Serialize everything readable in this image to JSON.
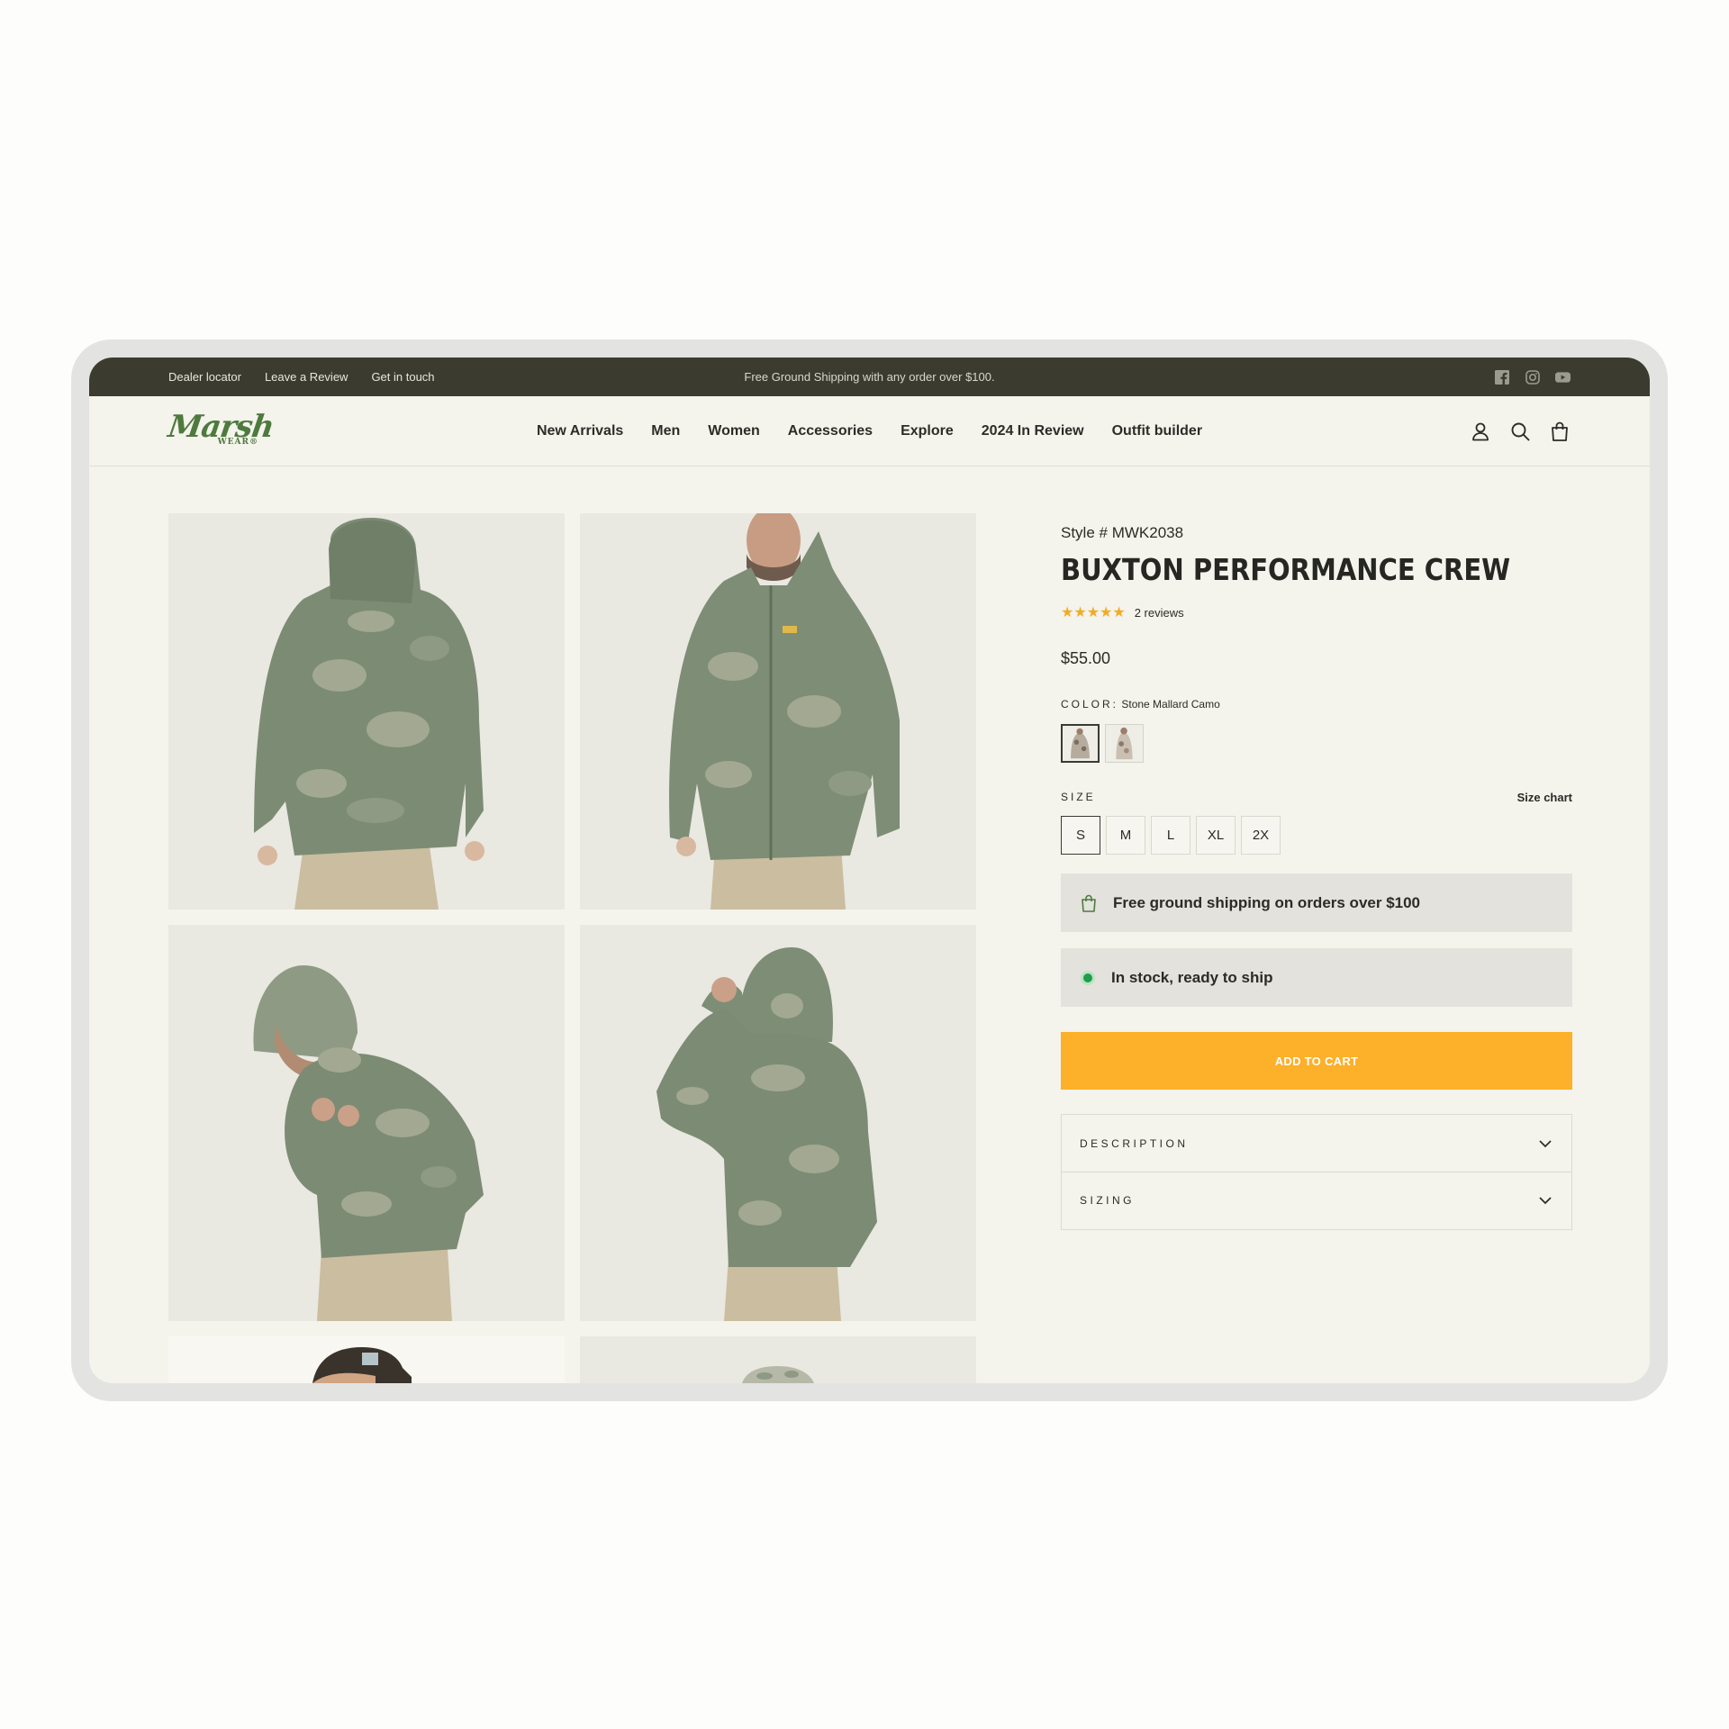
{
  "announcement": {
    "links": [
      "Dealer locator",
      "Leave a Review",
      "Get in touch"
    ],
    "promo": "Free Ground Shipping with any order over $100.",
    "social_icons": [
      "facebook-icon",
      "instagram-icon",
      "youtube-icon"
    ]
  },
  "brand": {
    "logo_script": "Marsh",
    "logo_sub": "WEAR®",
    "color": "#4e7a3e"
  },
  "nav": {
    "items": [
      "New Arrivals",
      "Men",
      "Women",
      "Accessories",
      "Explore",
      "2024 In Review",
      "Outfit builder"
    ],
    "icons": [
      "account-icon",
      "search-icon",
      "cart-icon"
    ]
  },
  "gallery": {
    "images": [
      "jacket-back-view",
      "jacket-front-view",
      "jacket-hood-up-front",
      "jacket-hood-up-back",
      "cap-side-view",
      "cap-front-view"
    ]
  },
  "product": {
    "style": "Style # MWK2038",
    "title": "BUXTON PERFORMANCE CREW",
    "rating": 5,
    "stars": "★★★★★",
    "reviews": "2 reviews",
    "price": "$55.00",
    "color_label": "COLOR:",
    "color_value": "Stone Mallard Camo",
    "swatches": [
      "Stone Mallard Camo",
      "Alternate camo"
    ],
    "size_label": "SIZE",
    "size_chart": "Size chart",
    "sizes": [
      "S",
      "M",
      "L",
      "XL",
      "2X"
    ],
    "selected_size": "S",
    "shipping_note": "Free ground shipping on orders over $100",
    "stock_note": "In stock, ready to ship",
    "add_to_cart": "ADD TO CART",
    "accordions": [
      "DESCRIPTION",
      "SIZING"
    ]
  },
  "colors": {
    "topbar": "#3b3c2f",
    "background": "#f4f3ec",
    "cta": "#fdb029",
    "star": "#f2ac24",
    "stock_dot": "#1f9d4a"
  }
}
